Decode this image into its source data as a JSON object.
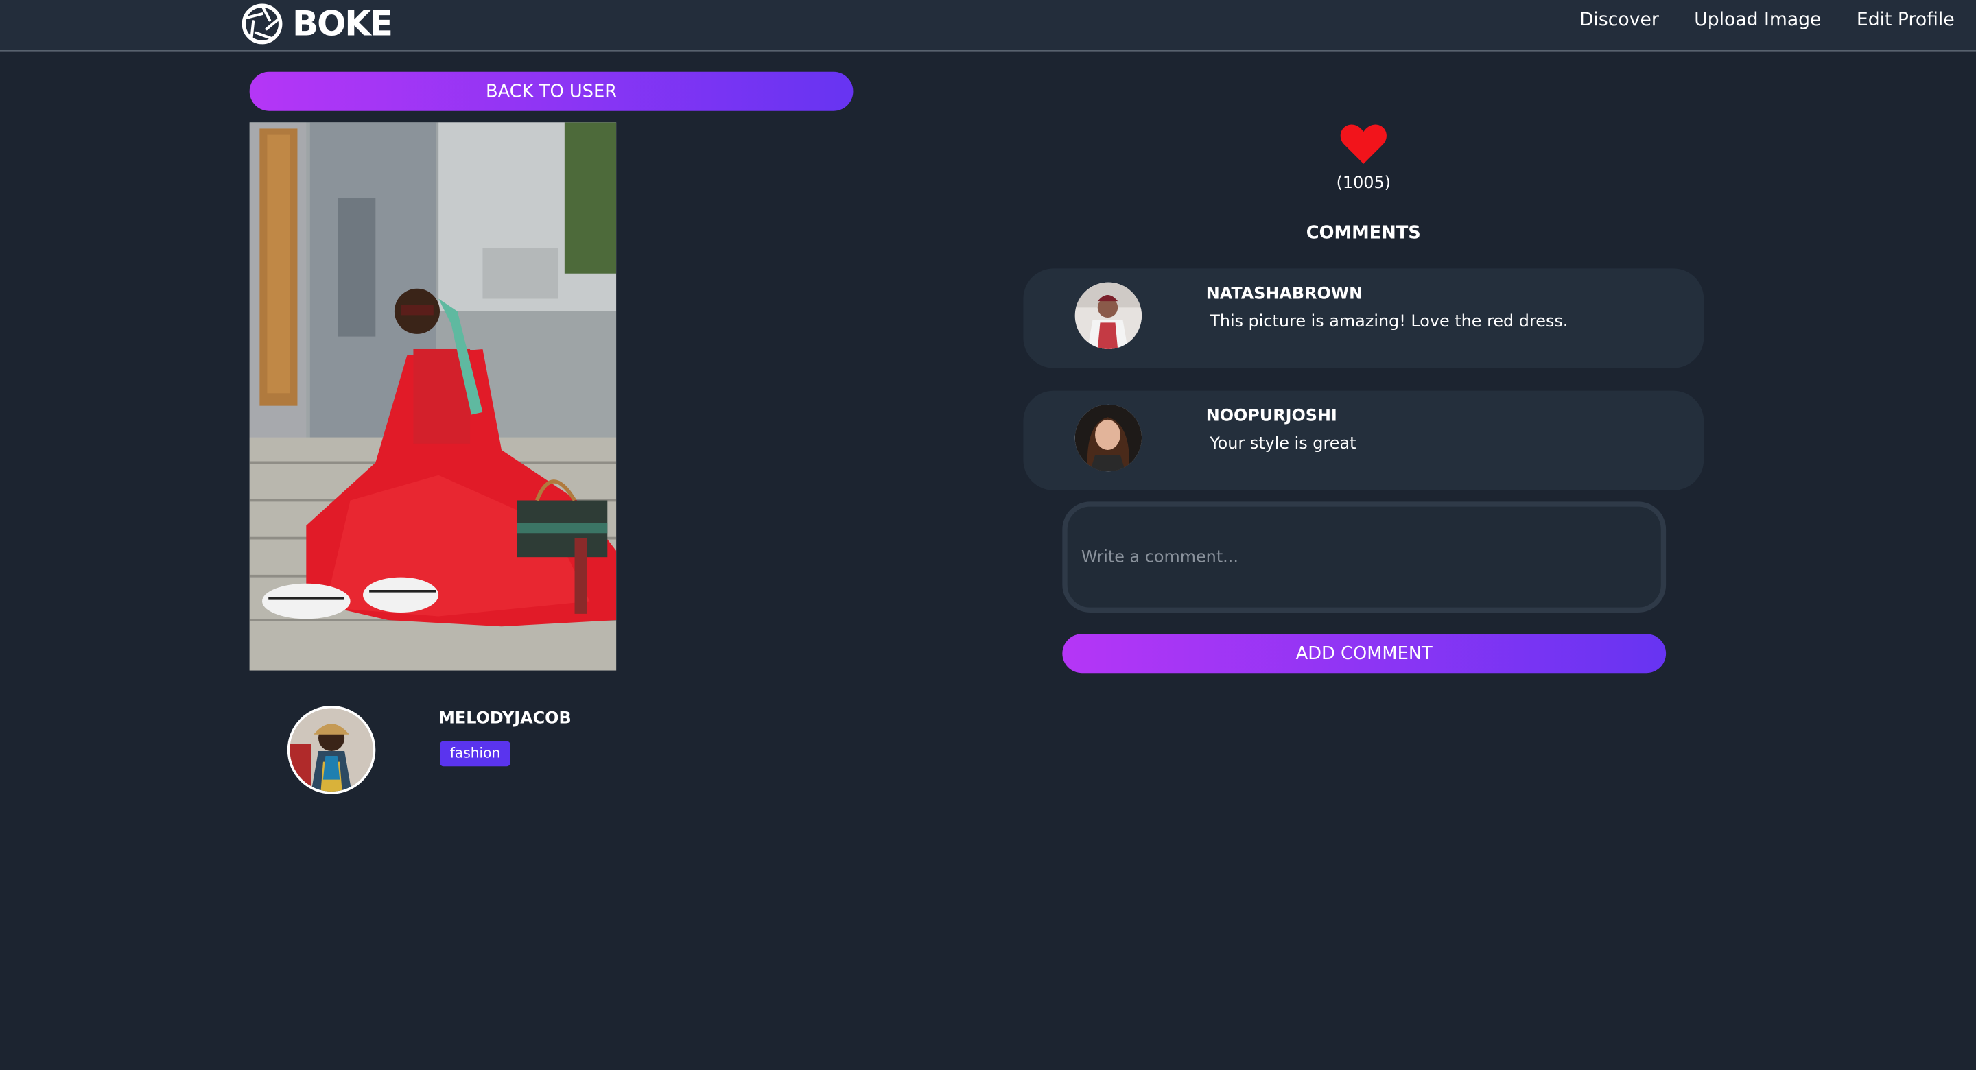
{
  "navbar": {
    "logo_text": "BOKE",
    "links": [
      "Discover",
      "Upload Image",
      "Edit Profile"
    ]
  },
  "back_button_label": "BACK TO USER",
  "post": {
    "owner": "MELODYJACOB",
    "tag": "fashion",
    "likes_label": "(1005)"
  },
  "comments_title": "COMMENTS",
  "comments": [
    {
      "user": "NATASHABROWN",
      "text": "This picture is amazing! Love the red dress."
    },
    {
      "user": "NOOPURJOSHI",
      "text": "Your style is great"
    }
  ],
  "comment_input": {
    "value": "",
    "placeholder": "Write a comment..."
  },
  "add_comment_label": "ADD COMMENT",
  "colors": {
    "background": "#1c2430",
    "navbar": "#232d3b",
    "card": "#242f3c",
    "gradient_start": "#b536f6",
    "gradient_end": "#6734f2",
    "tag": "#5a34ee",
    "heart": "#f2141b"
  },
  "icons": {
    "logo": "aperture-icon",
    "like": "heart-icon"
  }
}
